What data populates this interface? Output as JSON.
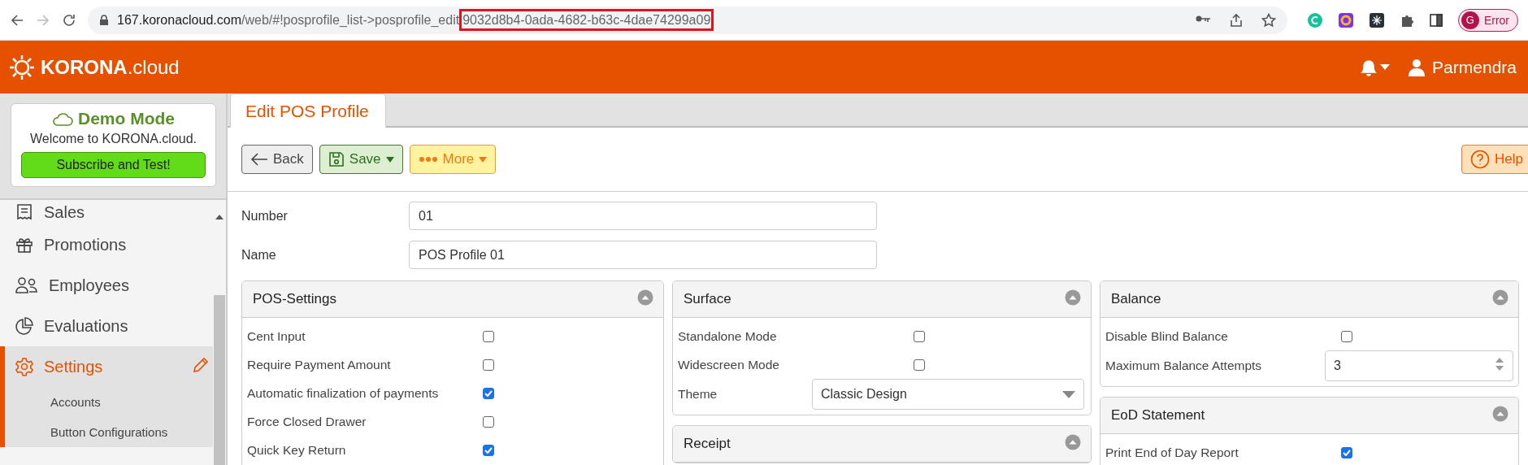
{
  "browser": {
    "url_host": "167.koronacloud.com",
    "url_path": "/web/#!posprofile_list->posprofile_edit",
    "url_highlight": "9032d8b4-0ada-4682-b63c-4dae74299a09",
    "profile_initial": "G",
    "profile_status": "Error"
  },
  "header": {
    "logo_bold": "KORONA",
    "logo_rest": ".cloud",
    "user": "Parmendra"
  },
  "demo": {
    "title": "Demo Mode",
    "text": "Welcome to KORONA.cloud.",
    "button": "Subscribe and Test!"
  },
  "sidebar": {
    "items": [
      {
        "label": "Sales",
        "kind": "main",
        "selected": false
      },
      {
        "label": "Promotions",
        "kind": "main",
        "selected": false
      },
      {
        "label": "Employees",
        "kind": "main",
        "selected": false
      },
      {
        "label": "Evaluations",
        "kind": "main",
        "selected": false
      },
      {
        "label": "Settings",
        "kind": "main",
        "selected": true
      },
      {
        "label": "Accounts",
        "kind": "sub",
        "selected": false
      },
      {
        "label": "Button Configurations",
        "kind": "sub",
        "selected": false
      }
    ]
  },
  "tabs": [
    {
      "label": "Edit POS Profile",
      "selected": true
    }
  ],
  "toolbar": [
    {
      "label": "Back",
      "kind": "back"
    },
    {
      "label": "Save",
      "kind": "save"
    },
    {
      "label": "More",
      "kind": "more"
    }
  ],
  "help_button": {
    "label": "Help"
  },
  "fields": [
    {
      "label": "Number",
      "value": "01"
    },
    {
      "label": "Name",
      "value": "POS Profile 01"
    }
  ],
  "panel_columns": [
    [
      {
        "title": "POS-Settings",
        "rows": [
          {
            "label": "Cent Input",
            "kind": "checkbox",
            "checked": false
          },
          {
            "label": "Require Payment Amount",
            "kind": "checkbox",
            "checked": false
          },
          {
            "label": "Automatic finalization of payments",
            "kind": "checkbox",
            "checked": true
          },
          {
            "label": "Force Closed Drawer",
            "kind": "checkbox",
            "checked": false
          },
          {
            "label": "Quick Key Return",
            "kind": "checkbox",
            "checked": true
          }
        ]
      }
    ],
    [
      {
        "title": "Surface",
        "rows": [
          {
            "label": "Standalone Mode",
            "kind": "checkbox",
            "checked": false
          },
          {
            "label": "Widescreen Mode",
            "kind": "checkbox",
            "checked": false
          },
          {
            "label": "Theme",
            "kind": "select",
            "value": "Classic Design"
          }
        ]
      },
      {
        "title": "Receipt"
      }
    ],
    [
      {
        "title": "Balance",
        "rows": [
          {
            "label": "Disable Blind Balance",
            "kind": "checkbox",
            "checked": false
          },
          {
            "label": "Maximum Balance Attempts",
            "kind": "number",
            "value": "3"
          }
        ]
      },
      {
        "title": "EoD Statement",
        "rows": [
          {
            "label": "Print End of Day Report",
            "kind": "checkbox",
            "checked": true
          }
        ]
      }
    ]
  ]
}
